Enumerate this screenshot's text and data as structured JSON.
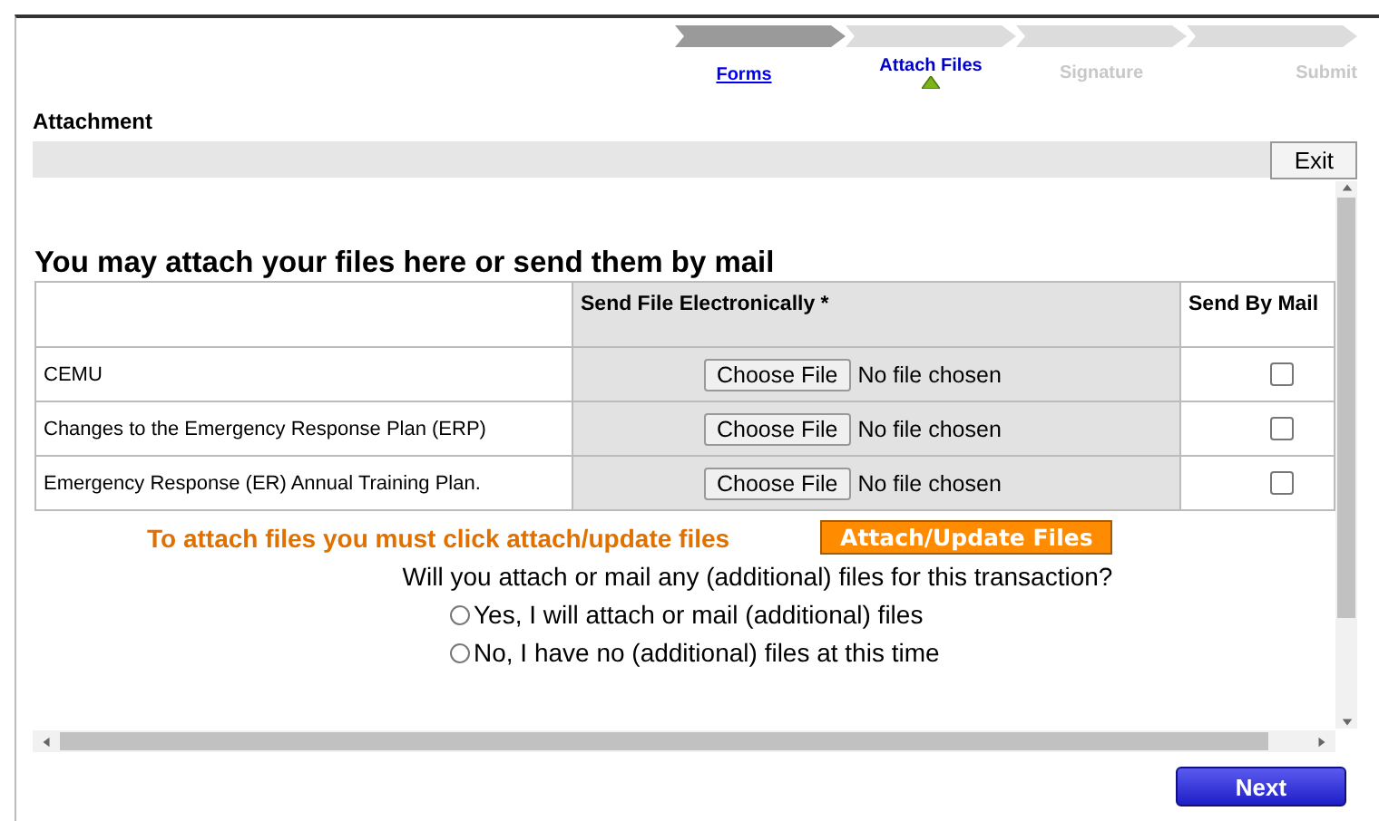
{
  "steps": [
    {
      "label": "Forms",
      "completed": true,
      "selected": false
    },
    {
      "label": "Attach Files",
      "completed": false,
      "selected": true
    },
    {
      "label": "Signature",
      "completed": false,
      "selected": false
    },
    {
      "label": "Submit",
      "completed": false,
      "selected": false
    }
  ],
  "section_title": "Attachment",
  "exit_button": "Exit",
  "heading": "You may attach your files here or send them by mail",
  "table": {
    "columns": [
      "",
      "Send File Electronically *",
      "Send By Mail"
    ],
    "rows": [
      {
        "document": "CEMU",
        "file_button": "Choose File",
        "file_status": "No file chosen",
        "mail_checked": false
      },
      {
        "document": "Changes to the Emergency Response Plan (ERP)",
        "file_button": "Choose File",
        "file_status": "No file chosen",
        "mail_checked": false
      },
      {
        "document": "Emergency Response (ER) Annual Training Plan.",
        "file_button": "Choose File",
        "file_status": "No file chosen",
        "mail_checked": false
      }
    ]
  },
  "attach_note": "To attach files you must click attach/update files",
  "attach_button": "Attach/Update Files",
  "question": "Will you attach or mail any (additional) files for this transaction?",
  "options": [
    {
      "label": "Yes, I will attach or mail (additional) files",
      "selected": false
    },
    {
      "label": "No, I have no (additional) files at this time",
      "selected": false
    }
  ],
  "next_button": "Next"
}
